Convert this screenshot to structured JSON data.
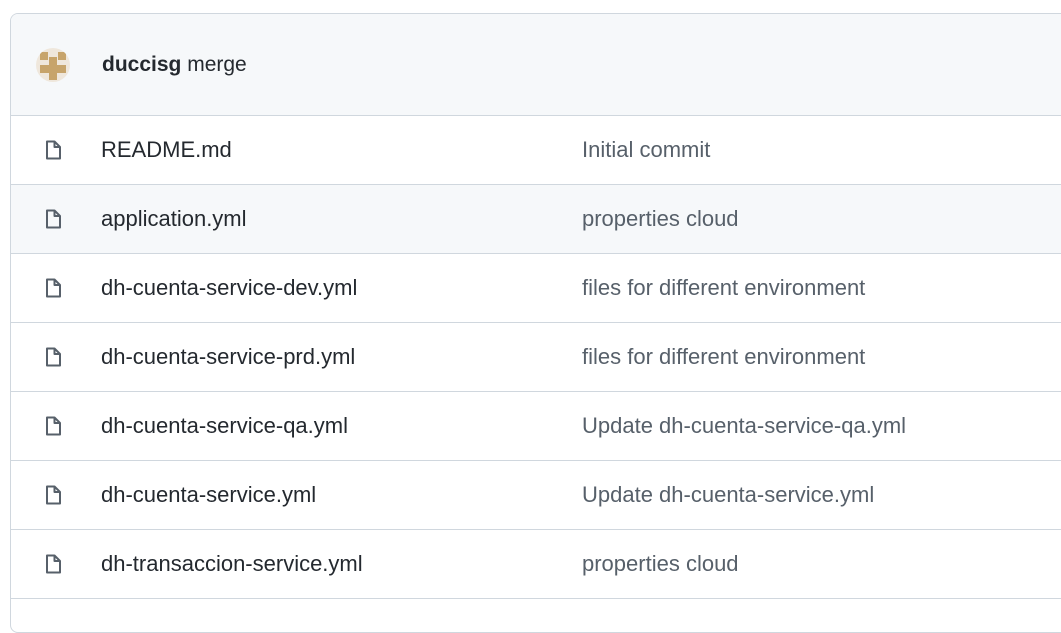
{
  "latest_commit": {
    "author": "duccisg",
    "message": "merge"
  },
  "files": [
    {
      "name": "README.md",
      "commit": "Initial commit",
      "icon": "file-icon"
    },
    {
      "name": "application.yml",
      "commit": "properties cloud",
      "icon": "file-icon"
    },
    {
      "name": "dh-cuenta-service-dev.yml",
      "commit": "files for different environment",
      "icon": "file-icon"
    },
    {
      "name": "dh-cuenta-service-prd.yml",
      "commit": "files for different environment",
      "icon": "file-icon"
    },
    {
      "name": "dh-cuenta-service-qa.yml",
      "commit": "Update dh-cuenta-service-qa.yml",
      "icon": "file-icon"
    },
    {
      "name": "dh-cuenta-service.yml",
      "commit": "Update dh-cuenta-service.yml",
      "icon": "file-icon"
    },
    {
      "name": "dh-transaccion-service.yml",
      "commit": "properties cloud",
      "icon": "file-icon"
    }
  ],
  "colors": {
    "border": "#d0d7de",
    "header_bg": "#f6f8fa",
    "text": "#24292f",
    "muted": "#57606a"
  }
}
